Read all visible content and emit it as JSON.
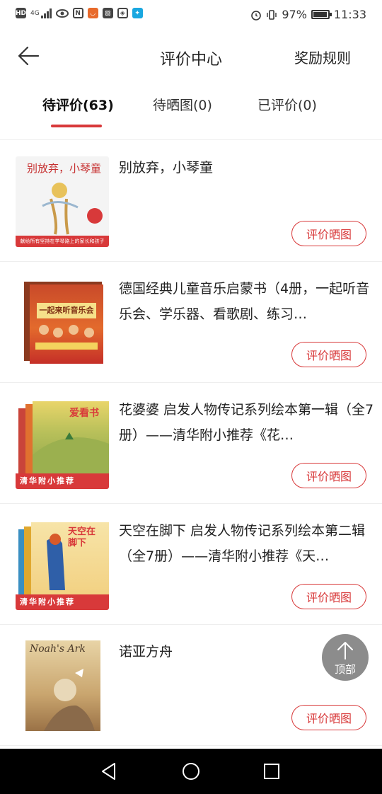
{
  "status_bar": {
    "left_icons": [
      "hd-icon",
      "4g-signal-icon",
      "eye-icon",
      "nfc-icon",
      "app-icon",
      "image-icon",
      "shield-icon",
      "lightbulb-icon"
    ],
    "hd_text": "HD",
    "network_text": "4G",
    "battery_percent": "97%",
    "time": "11:33"
  },
  "header": {
    "back_icon": "arrow-left-icon",
    "title": "评价中心",
    "rules": "奖励规则"
  },
  "tabs": [
    {
      "label": "待评价(63)",
      "active": true
    },
    {
      "label": "待晒图(0)",
      "active": false
    },
    {
      "label": "已评价(0)",
      "active": false
    }
  ],
  "items": [
    {
      "title": "别放弃，小琴童",
      "button": "评价晒图",
      "cover_text": "别放弃，小琴童",
      "cover_strip": "献给所有坚持在学琴路上的家长和孩子"
    },
    {
      "title": "德国经典儿童音乐启蒙书（4册，一起听音乐会、学乐器、看歌剧、练习…",
      "button": "评价晒图",
      "cover_text": "一起来听音乐会"
    },
    {
      "title": "花婆婆 启发人物传记系列绘本第一辑（全7册）——清华附小推荐《花…",
      "button": "评价晒图",
      "cover_text": "爱看书",
      "cover_strip": "清华附小推荐"
    },
    {
      "title": "天空在脚下 启发人物传记系列绘本第二辑（全7册）——清华附小推荐《天…",
      "button": "评价晒图",
      "cover_text": "天空在脚下",
      "cover_strip": "清华附小推荐"
    },
    {
      "title": "诺亚方舟",
      "button": "评价晒图",
      "cover_text": "Noah's Ark"
    }
  ],
  "to_top": {
    "label": "顶部",
    "icon": "arrow-up-icon"
  },
  "nav_bar": {
    "icons": [
      "back-triangle-icon",
      "home-circle-icon",
      "recents-square-icon"
    ]
  },
  "colors": {
    "accent": "#d8393a"
  }
}
